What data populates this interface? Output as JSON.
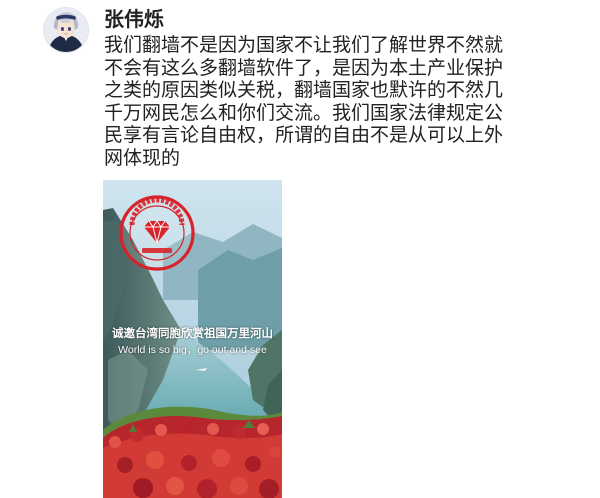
{
  "post": {
    "username": "张伟烁",
    "content_lines": [
      "我们翻墙不是因为国家不让我们了解世界不然就",
      "不会有这么多翻墙软件了，是因为本土产业保护",
      "之类的原因类似关税，翻墙国家也默许的不然几",
      "千万网民怎么和你们交流。我们国家法律规定公",
      "民享有言论自由权，所谓的自由不是从可以上外",
      "网体现的"
    ],
    "image": {
      "caption_cn": "诚邀台湾同胞欣赏祖国万里河山",
      "caption_en": "World is so big，go out and see",
      "stamp_icon": "diamond-icon",
      "stamp_color": "#d8232a"
    }
  },
  "colors": {
    "text": "#222222",
    "background": "#ffffff",
    "accent": "#d8232a"
  }
}
